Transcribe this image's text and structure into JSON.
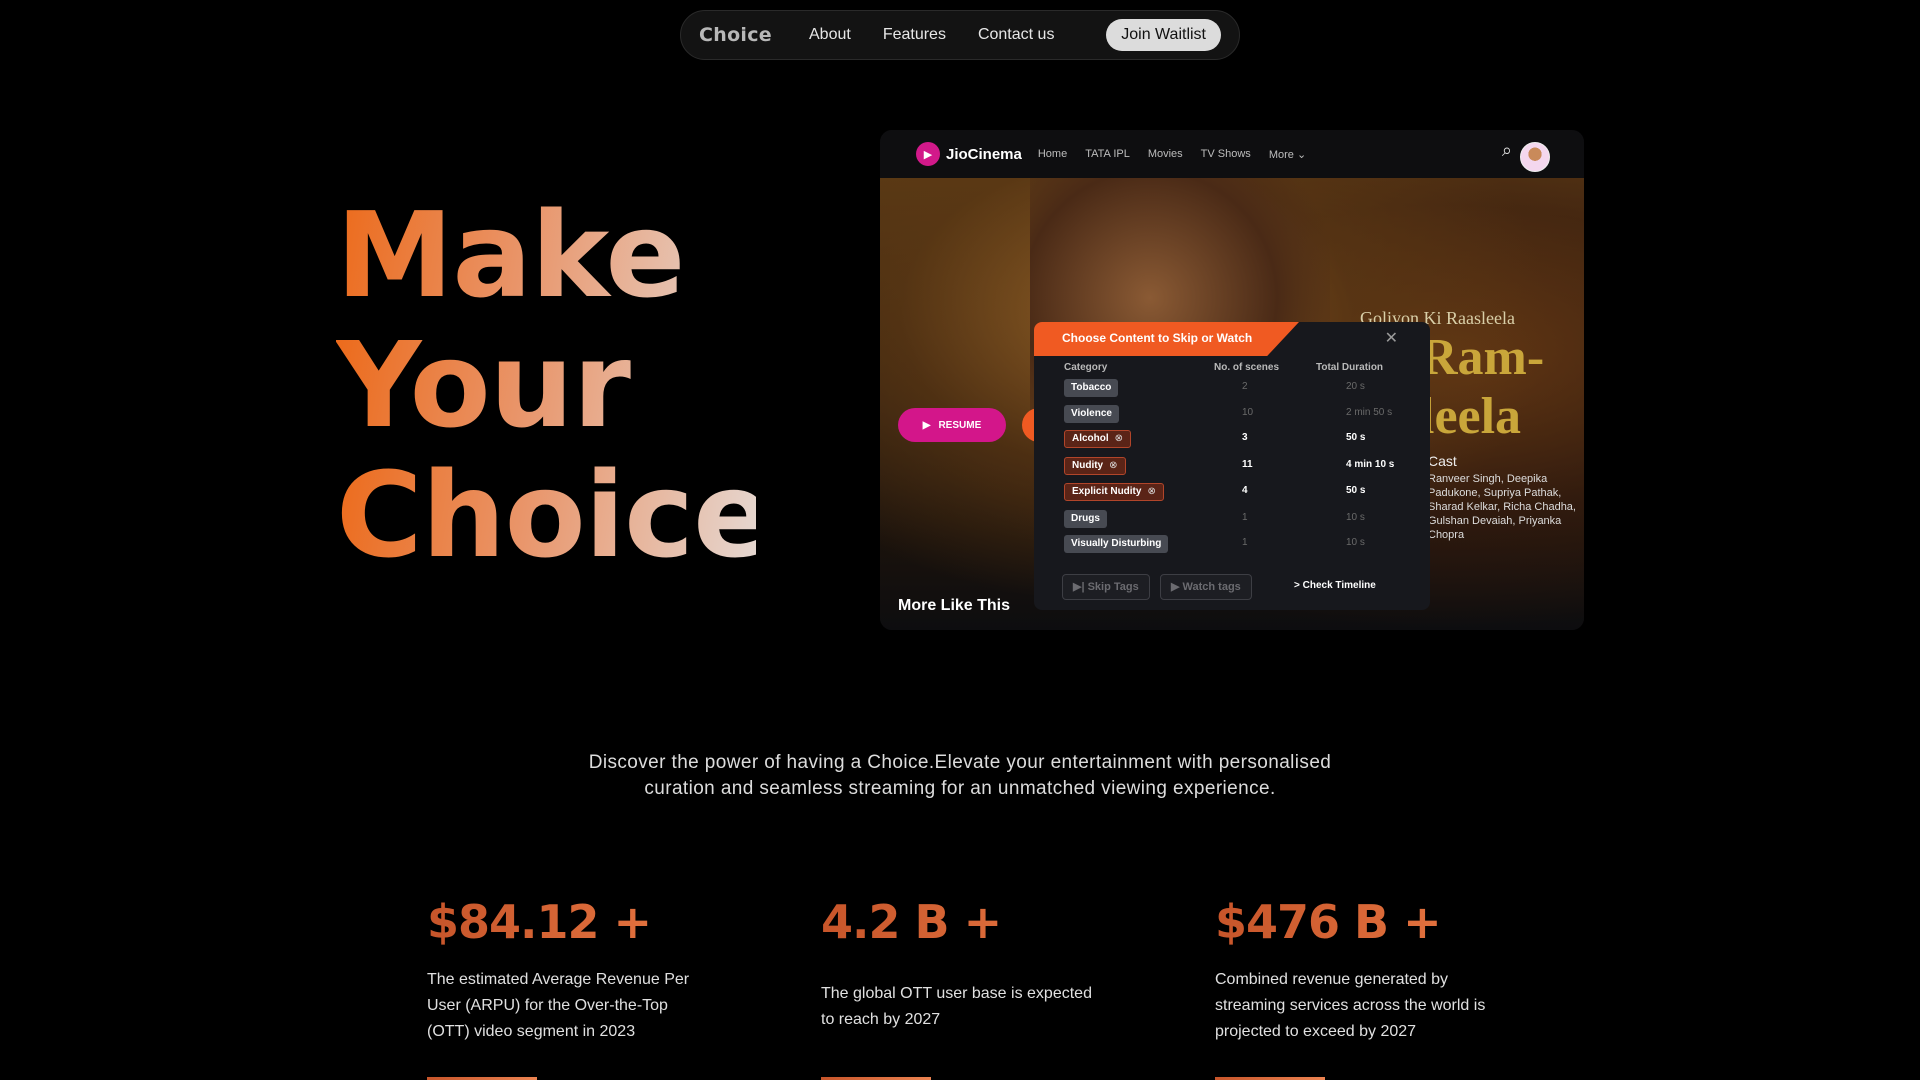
{
  "nav": {
    "logo": "Choice",
    "links": [
      "About",
      "Features",
      "Contact us"
    ],
    "cta": "Join Waitlist"
  },
  "hero": {
    "lines": [
      "Make",
      "Your",
      "Choice"
    ],
    "gradient": [
      "#ec6a1a",
      "#e9956a",
      "#e5d8d2"
    ]
  },
  "mock": {
    "brand": "JioCinema",
    "brand_color": "#d3168a",
    "nav": [
      "Home",
      "TATA IPL",
      "Movies",
      "TV Shows",
      "More"
    ],
    "title_sub": "Goliyon Ki Raasleela",
    "title_big": "Ram-leela",
    "cast_label": "Cast",
    "cast": "Ranveer Singh, Deepika Padukone, Supriya Pathak, Sharad Kelkar, Richa Chadha, Gulshan Devaiah, Priyanka Chopra",
    "resume": "RESUME",
    "more_like_this": "More Like This",
    "dialog": {
      "title": "Choose Content to Skip or Watch",
      "accent": "#f05a22",
      "columns": [
        "Category",
        "No. of scenes",
        "Total Duration"
      ],
      "rows": [
        {
          "category": "Tobacco",
          "scenes": "2",
          "duration": "20 s",
          "selected": false
        },
        {
          "category": "Violence",
          "scenes": "10",
          "duration": "2 min 50 s",
          "selected": false
        },
        {
          "category": "Alcohol",
          "scenes": "3",
          "duration": "50 s",
          "selected": true
        },
        {
          "category": "Nudity",
          "scenes": "11",
          "duration": "4 min 10 s",
          "selected": true
        },
        {
          "category": "Explicit Nudity",
          "scenes": "4",
          "duration": "50 s",
          "selected": true
        },
        {
          "category": "Drugs",
          "scenes": "1",
          "duration": "10 s",
          "selected": false
        },
        {
          "category": "Visually Disturbing",
          "scenes": "1",
          "duration": "10 s",
          "selected": false
        }
      ],
      "skip_btn": "▶| Skip Tags",
      "watch_btn": "▶ Watch tags",
      "timeline": "> Check Timeline"
    }
  },
  "tagline": {
    "line1": "Discover the power of having a Choice.Elevate your entertainment with personalised",
    "line2": "curation and seamless streaming for an unmatched viewing experience."
  },
  "stats": [
    {
      "value": "$84.12 +",
      "desc": "The estimated Average Revenue Per User (ARPU) for the Over-the-Top (OTT) video segment in 2023"
    },
    {
      "value": "4.2 B +",
      "desc": "The global OTT user base is expected to reach by 2027"
    },
    {
      "value": "$476 B +",
      "desc": "Combined revenue generated by streaming services across the world is projected to exceed by 2027"
    }
  ]
}
